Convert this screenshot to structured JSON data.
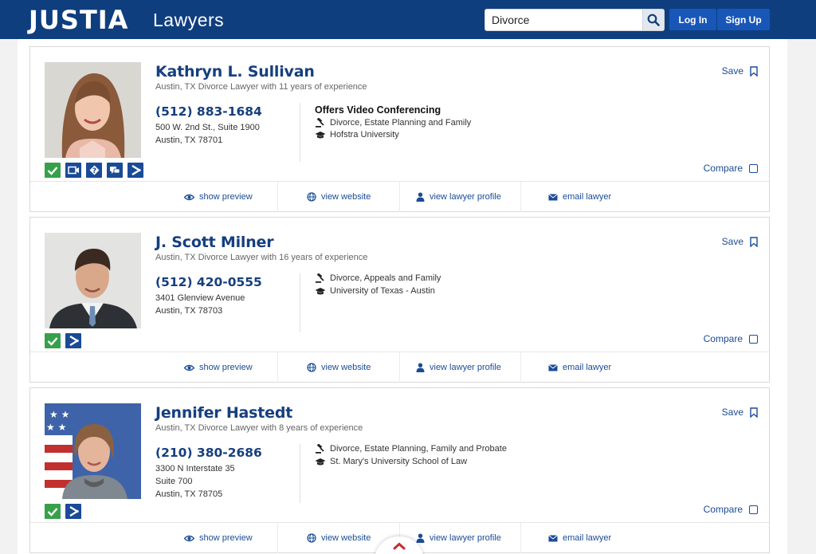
{
  "header": {
    "logo": "JUSTIA",
    "logo_sub": "Lawyers",
    "search_value": "Divorce",
    "login_label": "Log In",
    "signup_label": "Sign Up"
  },
  "colors": {
    "brand": "#0f3e7f",
    "link": "#1a4b97",
    "check_green": "#36a14a"
  },
  "cards": [
    {
      "name": "Kathryn L. Sullivan",
      "subtitle": "Austin, TX Divorce Lawyer with 11 years of experience",
      "phone": "(512) 883-1684",
      "address": [
        "500 W. 2nd St., Suite 1900",
        "Austin, TX 78701"
      ],
      "video_conferencing": "Offers Video Conferencing",
      "practice": "Divorce, Estate Planning and Family",
      "school": "Hofstra University",
      "badges": [
        "check-icon",
        "video-icon",
        "question-icon",
        "chat-icon",
        "share-icon"
      ]
    },
    {
      "name": "J. Scott Milner",
      "subtitle": "Austin, TX Divorce Lawyer with 16 years of experience",
      "phone": "(512) 420-0555",
      "address": [
        "3401 Glenview Avenue",
        "Austin, TX 78703"
      ],
      "practice": "Divorce, Appeals and Family",
      "school": "University of Texas - Austin",
      "badges": [
        "check-icon",
        "share-icon"
      ]
    },
    {
      "name": "Jennifer Hastedt",
      "subtitle": "Austin, TX Divorce Lawyer with 8 years of experience",
      "phone": "(210) 380-2686",
      "address": [
        "3300 N Interstate 35",
        "Suite 700",
        "Austin, TX 78705"
      ],
      "practice": "Divorce, Estate Planning, Family and Probate",
      "school": "St. Mary's University School of Law",
      "badges": [
        "check-icon",
        "share-icon"
      ]
    }
  ],
  "labels": {
    "save": "Save",
    "compare": "Compare",
    "show_preview": "show preview",
    "view_website": "view website",
    "view_profile": "view lawyer profile",
    "email_lawyer": "email lawyer"
  }
}
